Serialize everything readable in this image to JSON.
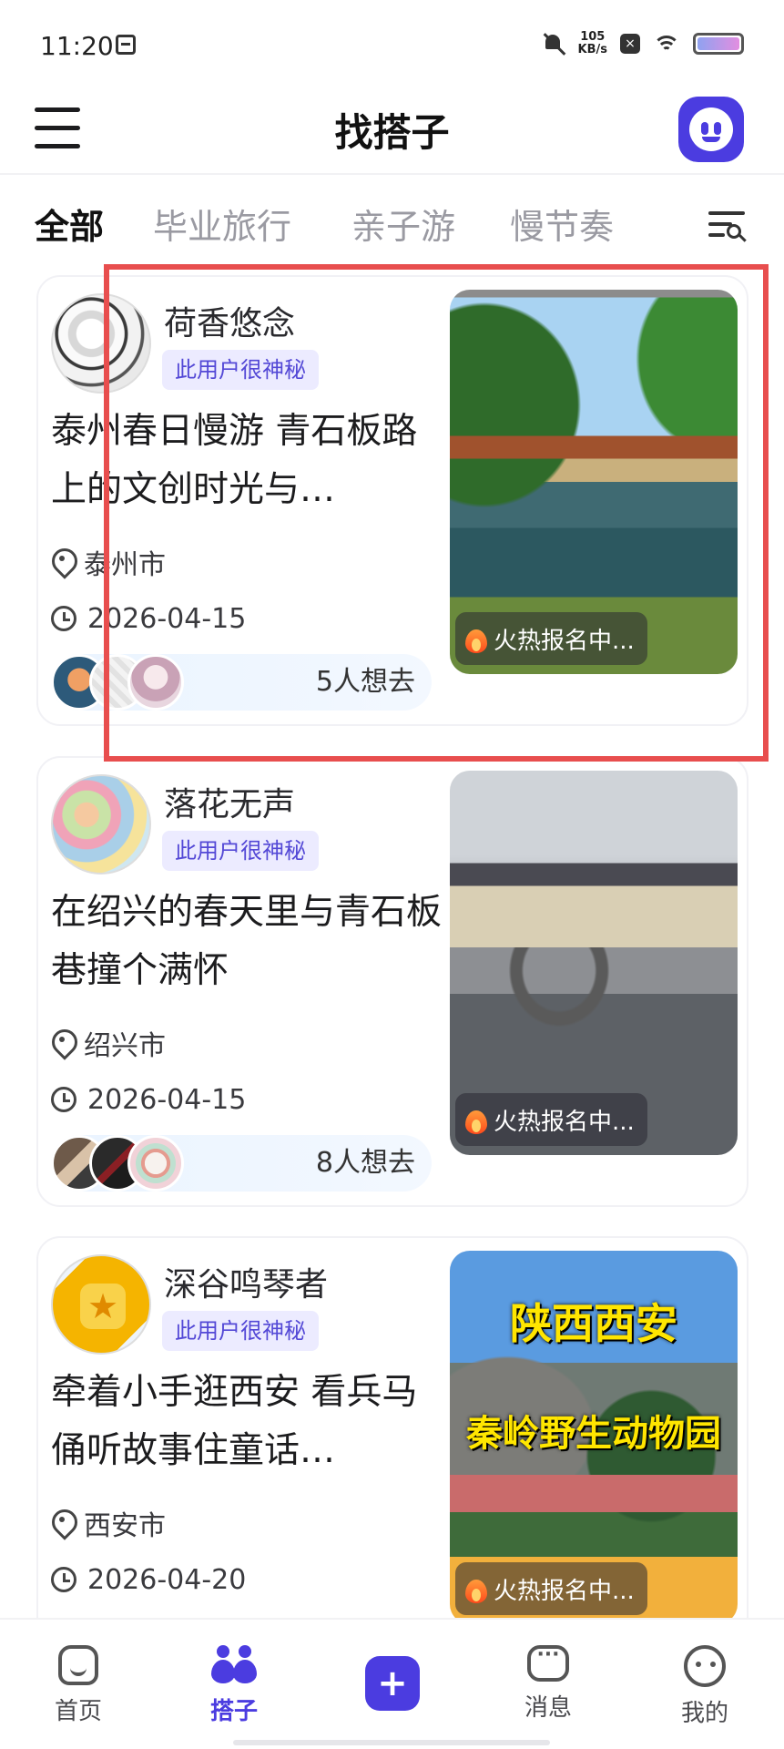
{
  "status_bar": {
    "time": "11:20",
    "net_speed_value": "105",
    "net_speed_unit": "KB/s"
  },
  "header": {
    "title": "找搭子"
  },
  "tabs": [
    {
      "label": "全部",
      "active": true
    },
    {
      "label": "毕业旅行",
      "active": false
    },
    {
      "label": "亲子游",
      "active": false
    },
    {
      "label": "慢节奏",
      "active": false
    }
  ],
  "cards": [
    {
      "username": "荷香悠念",
      "badge": "此用户很神秘",
      "title": "泰州春日慢游 青石板路上的文创时光与…",
      "location": "泰州市",
      "date": "2026-04-15",
      "want_count": "5人想去",
      "hot_label": "火热报名中..."
    },
    {
      "username": "落花无声",
      "badge": "此用户很神秘",
      "title": "在绍兴的春天里与青石板巷撞个满怀",
      "location": "绍兴市",
      "date": "2026-04-15",
      "want_count": "8人想去",
      "hot_label": "火热报名中..."
    },
    {
      "username": "深谷鸣琴者",
      "badge": "此用户很神秘",
      "title": "牵着小手逛西安 看兵马俑听故事住童话…",
      "location": "西安市",
      "date": "2026-04-20",
      "hot_label": "火热报名中...",
      "cover_caption_1": "陕西西安",
      "cover_caption_2": "秦岭野生动物园"
    }
  ],
  "bottom_nav": [
    {
      "label": "首页",
      "icon": "home-icon",
      "active": false
    },
    {
      "label": "搭子",
      "icon": "partner-icon",
      "active": true
    },
    {
      "label": "",
      "icon": "add-icon",
      "active": false
    },
    {
      "label": "消息",
      "icon": "message-icon",
      "active": false
    },
    {
      "label": "我的",
      "icon": "profile-icon",
      "active": false
    }
  ],
  "colors": {
    "accent": "#4b3ce0",
    "badge_bg": "#ecebff",
    "highlight": "#e84e4e"
  }
}
